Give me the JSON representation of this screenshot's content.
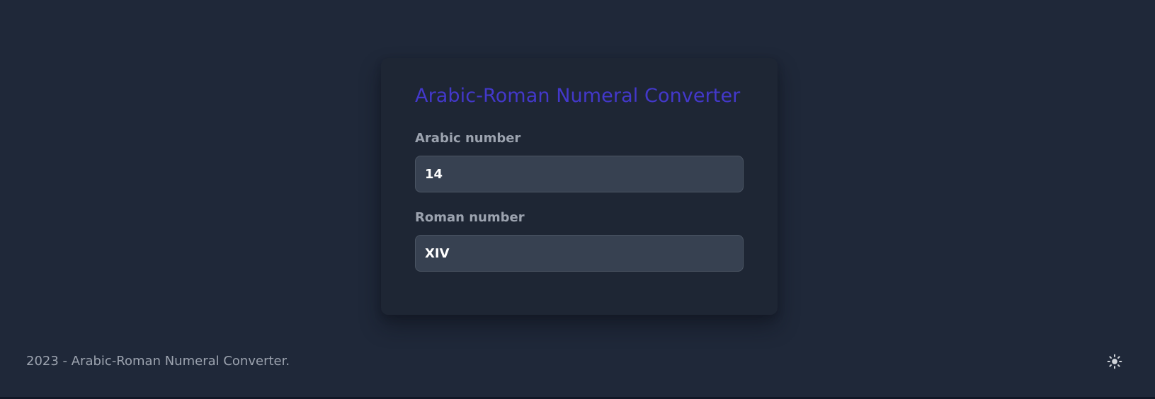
{
  "card": {
    "title": "Arabic-Roman Numeral Converter",
    "arabic": {
      "label": "Arabic number",
      "value": "14"
    },
    "roman": {
      "label": "Roman number",
      "value": "XIV"
    }
  },
  "footer": {
    "text": "2023 - Arabic-Roman Numeral Converter.",
    "theme_toggle_icon": "sun-icon"
  },
  "colors": {
    "background": "#1f2839",
    "card": "#1e2634",
    "title": "#4338ca",
    "label": "#9ca3af",
    "input_bg": "#374151",
    "input_border": "#4b5563",
    "input_text": "#ffffff",
    "icon": "#d1d5db"
  }
}
